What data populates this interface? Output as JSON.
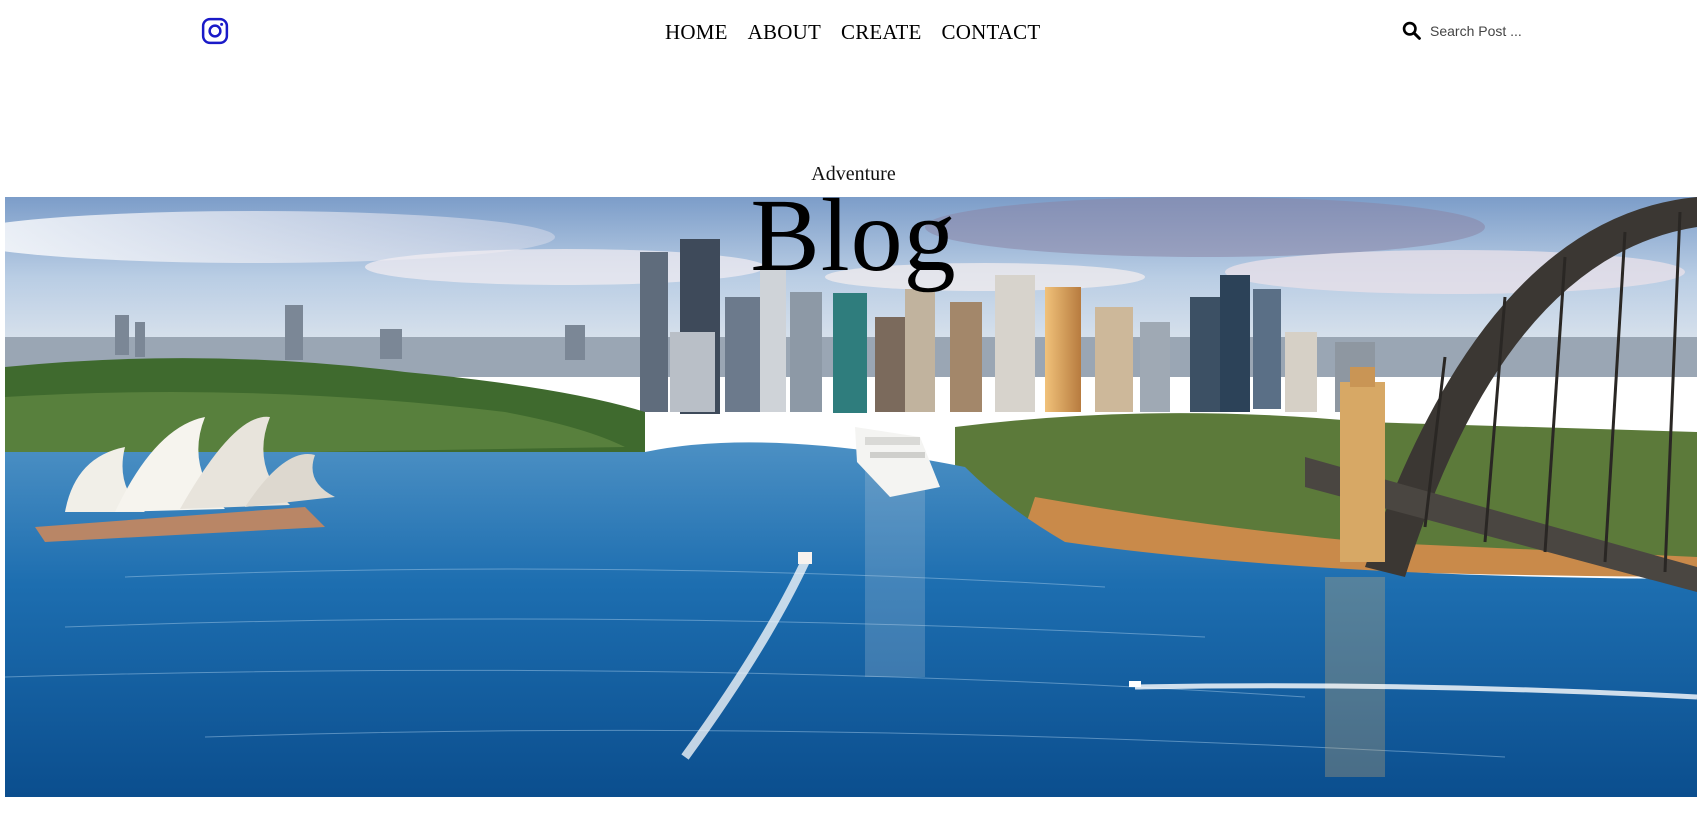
{
  "header": {
    "social_icon": "instagram-icon",
    "nav": [
      "HOME",
      "ABOUT",
      "CREATE",
      "CONTACT"
    ],
    "search": {
      "icon": "search-icon",
      "placeholder": "Search Post ..."
    }
  },
  "hero": {
    "subtitle": "Adventure",
    "title": "Blog",
    "image": "sydney-harbour-photo"
  },
  "colors": {
    "accent": "#1a1ac8",
    "text": "#000000"
  }
}
